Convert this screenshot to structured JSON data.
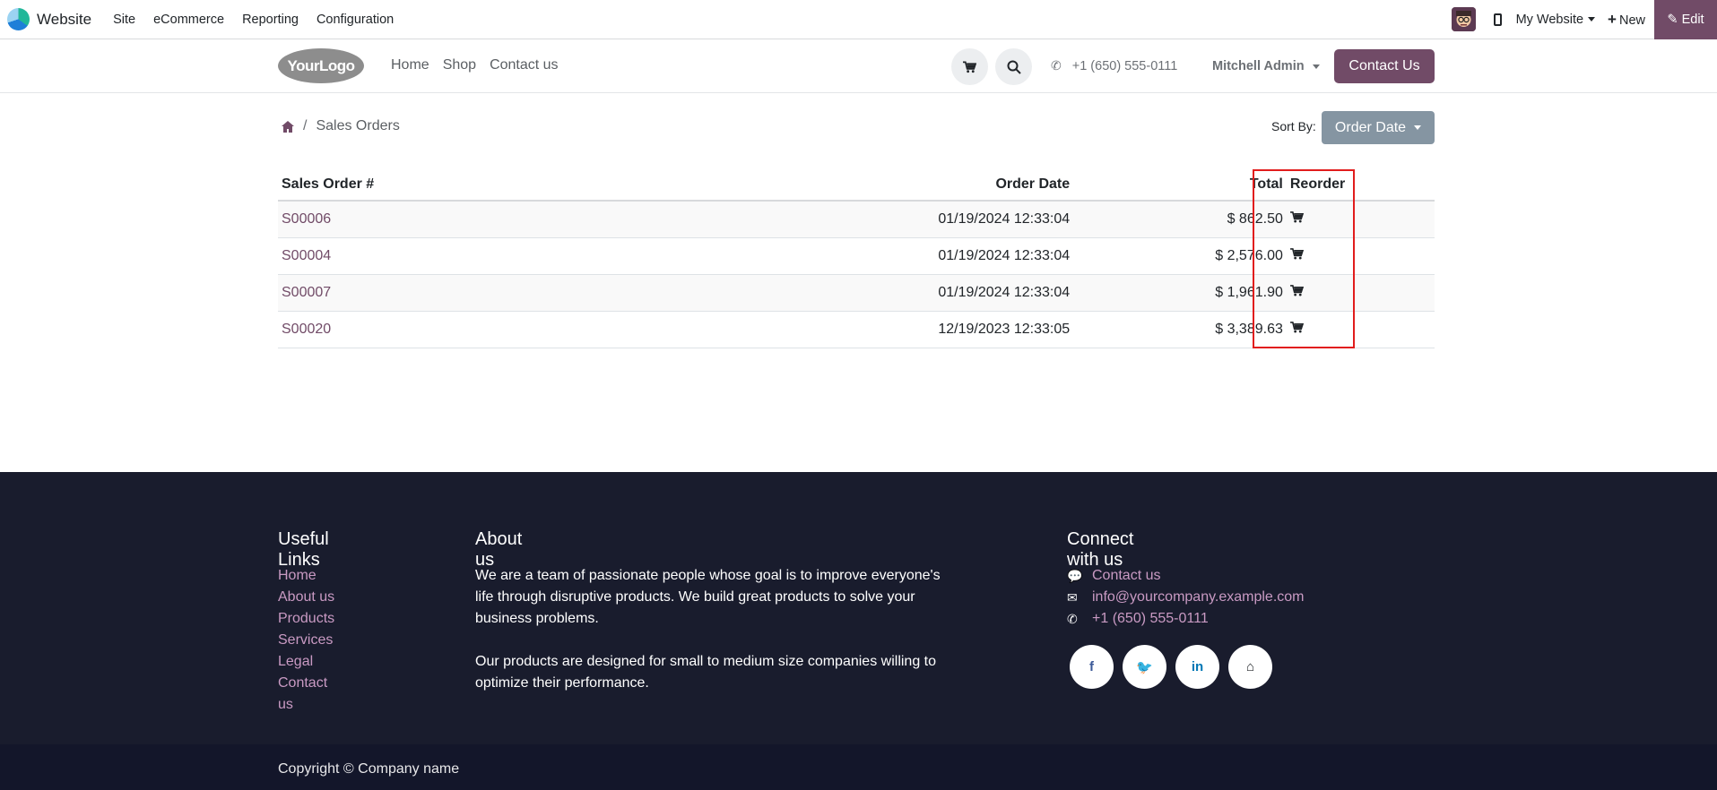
{
  "admin_bar": {
    "app_name": "Website",
    "menu": [
      "Site",
      "eCommerce",
      "Reporting",
      "Configuration"
    ],
    "my_website": "My Website",
    "new_label": "New",
    "edit_label": "Edit"
  },
  "header": {
    "logo_text": "YourLogo",
    "menu": [
      "Home",
      "Shop",
      "Contact us"
    ],
    "phone": "+1 (650) 555-0111",
    "user": "Mitchell Admin",
    "contact_button": "Contact Us"
  },
  "page": {
    "breadcrumb_current": "Sales Orders",
    "sort_label": "Sort By:",
    "sort_value": "Order Date"
  },
  "orders_table": {
    "headers": [
      "Sales Order #",
      "Order Date",
      "Total",
      "Reorder"
    ],
    "rows": [
      {
        "order": "S00006",
        "date": "01/19/2024  12:33:04",
        "total": "$ 862.50"
      },
      {
        "order": "S00004",
        "date": "01/19/2024  12:33:04",
        "total": "$ 2,576.00"
      },
      {
        "order": "S00007",
        "date": "01/19/2024  12:33:04",
        "total": "$ 1,961.90"
      },
      {
        "order": "S00020",
        "date": "12/19/2023  12:33:05",
        "total": "$ 3,389.63"
      }
    ]
  },
  "footer": {
    "useful_links_title": "Useful Links",
    "useful_links": [
      "Home",
      "About us",
      "Products",
      "Services",
      "Legal",
      "Contact us"
    ],
    "about_title": "About us",
    "about_p1": "We are a team of passionate people whose goal is to improve everyone's life through disruptive products. We build great products to solve your business problems.",
    "about_p2": "Our products are designed for small to medium size companies willing to optimize their performance.",
    "connect_title": "Connect with us",
    "contact_link": "Contact us",
    "email": "info@yourcompany.example.com",
    "phone": "+1 (650) 555-0111",
    "social_icons": [
      "facebook-icon",
      "twitter-icon",
      "linkedin-icon",
      "home-icon"
    ],
    "copyright": "Copyright © Company name"
  },
  "colors": {
    "brand": "#714b67",
    "footer_bg": "#191c2d",
    "highlight": "#e11d1d",
    "sort_button": "#8595a2"
  }
}
